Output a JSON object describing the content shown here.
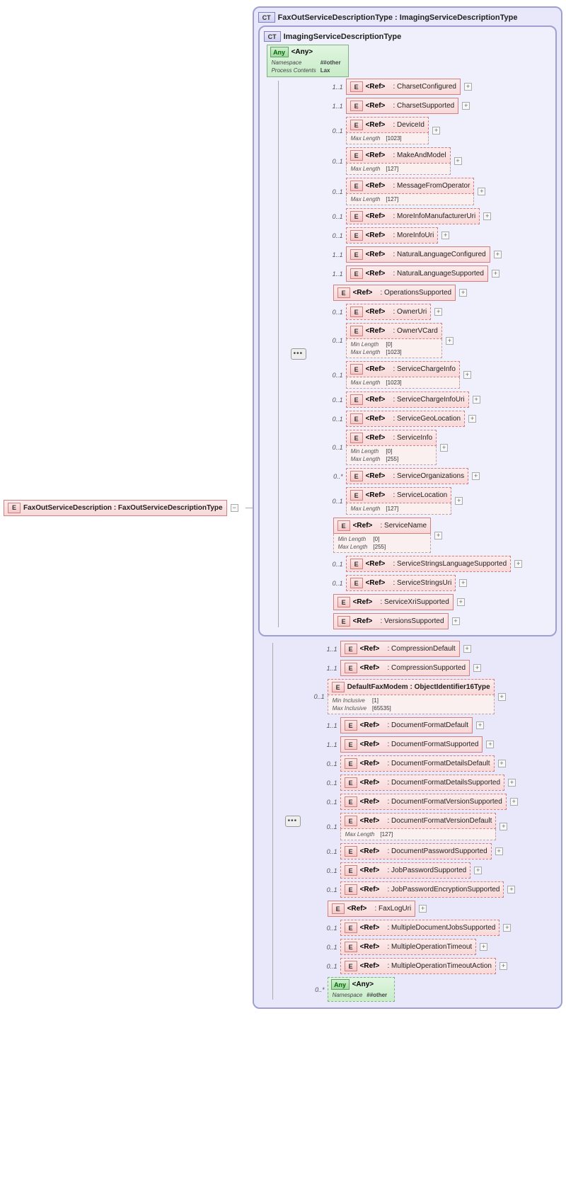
{
  "root": {
    "badge": "E",
    "label": "FaxOutServiceDescription : FaxOutServiceDescriptionType"
  },
  "outerCT": {
    "badge": "CT",
    "title": "FaxOutServiceDescriptionType : ImagingServiceDescriptionType"
  },
  "innerCT": {
    "badge": "CT",
    "title": "ImagingServiceDescriptionType"
  },
  "anyBlock": {
    "badge": "Any",
    "title": "<Any>",
    "namespace_label": "Namespace",
    "namespace_value": "##other",
    "process_label": "Process Contents",
    "process_value": "Lax"
  },
  "refText": "<Ref>",
  "facetLabels": {
    "maxLength": "Max Length",
    "minLength": "Min Length",
    "minInclusive": "Min Inclusive",
    "maxInclusive": "Max Inclusive",
    "namespace": "Namespace"
  },
  "innerElements": [
    {
      "card": "1..1",
      "name": "CharsetConfigured",
      "indent": 1,
      "dashed": false
    },
    {
      "card": "1..1",
      "name": "CharsetSupported",
      "indent": 1,
      "dashed": false
    },
    {
      "card": "0..1",
      "name": "DeviceId",
      "indent": 1,
      "dashed": true,
      "facets": [
        [
          "Max Length",
          "[1023]"
        ]
      ]
    },
    {
      "card": "0..1",
      "name": "MakeAndModel",
      "indent": 1,
      "dashed": true,
      "facets": [
        [
          "Max Length",
          "[127]"
        ]
      ]
    },
    {
      "card": "0..1",
      "name": "MessageFromOperator",
      "indent": 1,
      "dashed": true,
      "facets": [
        [
          "Max Length",
          "[127]"
        ]
      ]
    },
    {
      "card": "0..1",
      "name": "MoreInfoManufacturerUri",
      "indent": 1,
      "dashed": true
    },
    {
      "card": "0..1",
      "name": "MoreInfoUri",
      "indent": 1,
      "dashed": true
    },
    {
      "card": "1..1",
      "name": "NaturalLanguageConfigured",
      "indent": 1,
      "dashed": false
    },
    {
      "card": "1..1",
      "name": "NaturalLanguageSupported",
      "indent": 1,
      "dashed": false
    },
    {
      "card": "",
      "name": "OperationsSupported",
      "indent": 0,
      "dashed": false
    },
    {
      "card": "0..1",
      "name": "OwnerUri",
      "indent": 1,
      "dashed": true
    },
    {
      "card": "0..1",
      "name": "OwnerVCard",
      "indent": 1,
      "dashed": true,
      "facets": [
        [
          "Min Length",
          "[0]"
        ],
        [
          "Max Length",
          "[1023]"
        ]
      ]
    },
    {
      "card": "0..1",
      "name": "ServiceChargeInfo",
      "indent": 1,
      "dashed": true,
      "facets": [
        [
          "Max Length",
          "[1023]"
        ]
      ]
    },
    {
      "card": "0..1",
      "name": "ServiceChargeInfoUri",
      "indent": 1,
      "dashed": true
    },
    {
      "card": "0..1",
      "name": "ServiceGeoLocation",
      "indent": 1,
      "dashed": true
    },
    {
      "card": "0..1",
      "name": "ServiceInfo",
      "indent": 1,
      "dashed": true,
      "facets": [
        [
          "Min Length",
          "[0]"
        ],
        [
          "Max Length",
          "[255]"
        ]
      ]
    },
    {
      "card": "0..*",
      "name": "ServiceOrganizations",
      "indent": 1,
      "dashed": true
    },
    {
      "card": "0..1",
      "name": "ServiceLocation",
      "indent": 1,
      "dashed": true,
      "facets": [
        [
          "Max Length",
          "[127]"
        ]
      ]
    },
    {
      "card": "",
      "name": "ServiceName",
      "indent": 0,
      "dashed": false,
      "facets": [
        [
          "Min Length",
          "[0]"
        ],
        [
          "Max Length",
          "[255]"
        ]
      ]
    },
    {
      "card": "0..1",
      "name": "ServiceStringsLanguageSupported",
      "indent": 1,
      "dashed": true
    },
    {
      "card": "0..1",
      "name": "ServiceStringsUri",
      "indent": 1,
      "dashed": true
    },
    {
      "card": "",
      "name": "ServiceXriSupported",
      "indent": 0,
      "dashed": false
    },
    {
      "card": "",
      "name": "VersionsSupported",
      "indent": 0,
      "dashed": false
    }
  ],
  "outerElements": [
    {
      "card": "1..1",
      "name": "CompressionDefault",
      "indent": 1,
      "dashed": false
    },
    {
      "card": "1..1",
      "name": "CompressionSupported",
      "indent": 1,
      "dashed": false
    },
    {
      "card": "0..1",
      "label": "DefaultFaxModem : ObjectIdentifier16Type",
      "indent": 0,
      "dashed": true,
      "noRef": true,
      "facets": [
        [
          "Min Inclusive",
          "[1]"
        ],
        [
          "Max Inclusive",
          "[65535]"
        ]
      ]
    },
    {
      "card": "1..1",
      "name": "DocumentFormatDefault",
      "indent": 1,
      "dashed": false
    },
    {
      "card": "1..1",
      "name": "DocumentFormatSupported",
      "indent": 1,
      "dashed": false
    },
    {
      "card": "0..1",
      "name": "DocumentFormatDetailsDefault",
      "indent": 1,
      "dashed": true
    },
    {
      "card": "0..1",
      "name": "DocumentFormatDetailsSupported",
      "indent": 1,
      "dashed": true
    },
    {
      "card": "0..1",
      "name": "DocumentFormatVersionSupported",
      "indent": 1,
      "dashed": true
    },
    {
      "card": "0..1",
      "name": "DocumentFormatVersionDefault",
      "indent": 1,
      "dashed": true,
      "facets": [
        [
          "Max Length",
          "[127]"
        ]
      ]
    },
    {
      "card": "0..1",
      "name": "DocumentPasswordSupported",
      "indent": 1,
      "dashed": true
    },
    {
      "card": "0..1",
      "name": "JobPasswordSupported",
      "indent": 1,
      "dashed": true
    },
    {
      "card": "0..1",
      "name": "JobPasswordEncryptionSupported",
      "indent": 1,
      "dashed": true
    },
    {
      "card": "",
      "name": "FaxLogUri",
      "indent": 0,
      "dashed": false
    },
    {
      "card": "0..1",
      "name": "MultipleDocumentJobsSupported",
      "indent": 1,
      "dashed": true
    },
    {
      "card": "0..1",
      "name": "MultipleOperationTimeout",
      "indent": 1,
      "dashed": true
    },
    {
      "card": "0..1",
      "name": "MultipleOperationTimeoutAction",
      "indent": 1,
      "dashed": true
    }
  ],
  "outerAny": {
    "card": "0..*",
    "badge": "Any",
    "title": "<Any>",
    "namespace_label": "Namespace",
    "namespace_value": "##other"
  }
}
